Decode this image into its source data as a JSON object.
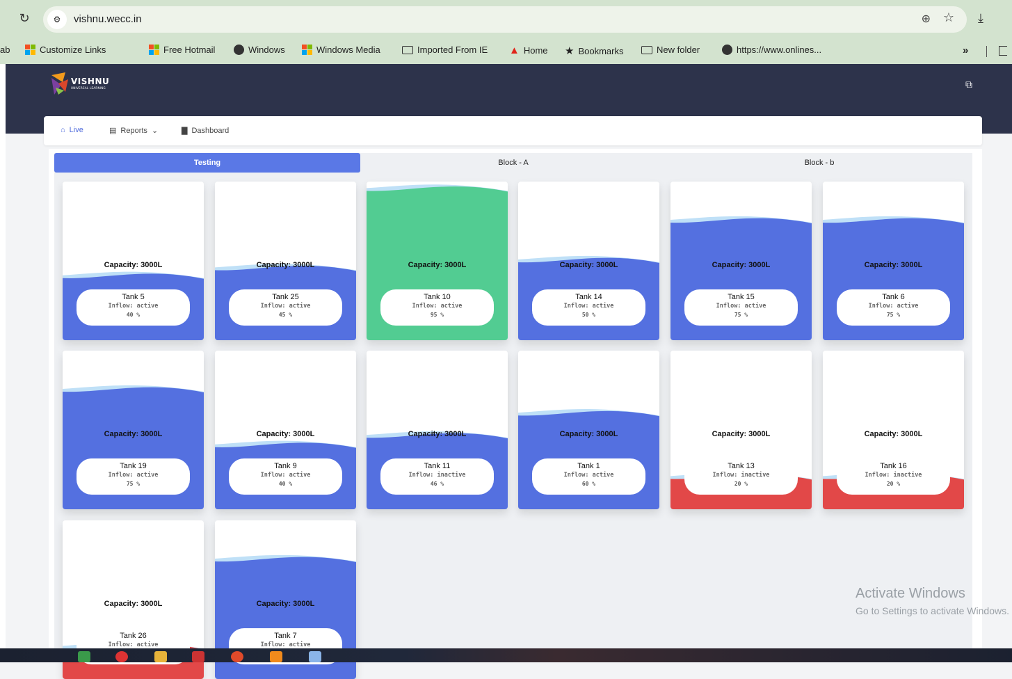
{
  "browser": {
    "url": "vishnu.wecc.in",
    "bookmarks": [
      {
        "label": "Customize Links",
        "icon": "windows-logo-icon"
      },
      {
        "label": "Free Hotmail",
        "icon": "windows-logo-icon"
      },
      {
        "label": "Windows",
        "icon": "globe-icon"
      },
      {
        "label": "Windows Media",
        "icon": "windows-logo-icon"
      },
      {
        "label": "Imported From IE",
        "icon": "folder-icon"
      },
      {
        "label": "Home",
        "icon": "adobe-icon"
      },
      {
        "label": "Bookmarks",
        "icon": "star-icon"
      },
      {
        "label": "New folder",
        "icon": "folder-icon"
      },
      {
        "label": "https://www.onlines...",
        "icon": "globe-icon"
      }
    ],
    "bookmark_cut": "ab",
    "more": "»"
  },
  "brand": {
    "name": "VISHNU",
    "sub": "UNIVERSAL LEARNING"
  },
  "nav": {
    "live": "Live",
    "reports": "Reports",
    "dashboard": "Dashboard"
  },
  "tabs": [
    "Testing",
    "Block - A",
    "Block - b"
  ],
  "colors": {
    "normal": "#5470e0",
    "full": "#52cc92",
    "low": "#e24848",
    "wave": "#bfe0f7"
  },
  "tanks": [
    {
      "name": "Tank 5",
      "capacity": "Capacity: 3000L",
      "inflow": "Inflow: active",
      "percent_label": "40 %",
      "level": 0.4,
      "status": "normal"
    },
    {
      "name": "Tank 25",
      "capacity": "Capacity: 3000L",
      "inflow": "Inflow: active",
      "percent_label": "45 %",
      "level": 0.45,
      "status": "normal"
    },
    {
      "name": "Tank 10",
      "capacity": "Capacity: 3000L",
      "inflow": "Inflow: active",
      "percent_label": "95 %",
      "level": 0.95,
      "status": "full"
    },
    {
      "name": "Tank 14",
      "capacity": "Capacity: 3000L",
      "inflow": "Inflow: active",
      "percent_label": "50 %",
      "level": 0.5,
      "status": "normal"
    },
    {
      "name": "Tank 15",
      "capacity": "Capacity: 3000L",
      "inflow": "Inflow: active",
      "percent_label": "75 %",
      "level": 0.75,
      "status": "normal"
    },
    {
      "name": "Tank 6",
      "capacity": "Capacity: 3000L",
      "inflow": "Inflow: active",
      "percent_label": "75 %",
      "level": 0.75,
      "status": "normal"
    },
    {
      "name": "Tank 19",
      "capacity": "Capacity: 3000L",
      "inflow": "Inflow: active",
      "percent_label": "75 %",
      "level": 0.75,
      "status": "normal"
    },
    {
      "name": "Tank 9",
      "capacity": "Capacity: 3000L",
      "inflow": "Inflow: active",
      "percent_label": "40 %",
      "level": 0.4,
      "status": "normal"
    },
    {
      "name": "Tank 11",
      "capacity": "Capacity: 3000L",
      "inflow": "Inflow: inactive",
      "percent_label": "46 %",
      "level": 0.46,
      "status": "normal"
    },
    {
      "name": "Tank 1",
      "capacity": "Capacity: 3000L",
      "inflow": "Inflow: active",
      "percent_label": "60 %",
      "level": 0.6,
      "status": "normal"
    },
    {
      "name": "Tank 13",
      "capacity": "Capacity: 3000L",
      "inflow": "Inflow: inactive",
      "percent_label": "20 %",
      "level": 0.2,
      "status": "low"
    },
    {
      "name": "Tank 16",
      "capacity": "Capacity: 3000L",
      "inflow": "Inflow: inactive",
      "percent_label": "20 %",
      "level": 0.2,
      "status": "low"
    },
    {
      "name": "Tank 26",
      "capacity": "Capacity: 3000L",
      "inflow": "Inflow: active",
      "percent_label": "",
      "level": 0.2,
      "status": "low"
    },
    {
      "name": "Tank 7",
      "capacity": "Capacity: 3000L",
      "inflow": "Inflow: active",
      "percent_label": "",
      "level": 0.75,
      "status": "normal"
    }
  ],
  "watermark": {
    "title": "Activate Windows",
    "sub": "Go to Settings to activate Windows."
  }
}
